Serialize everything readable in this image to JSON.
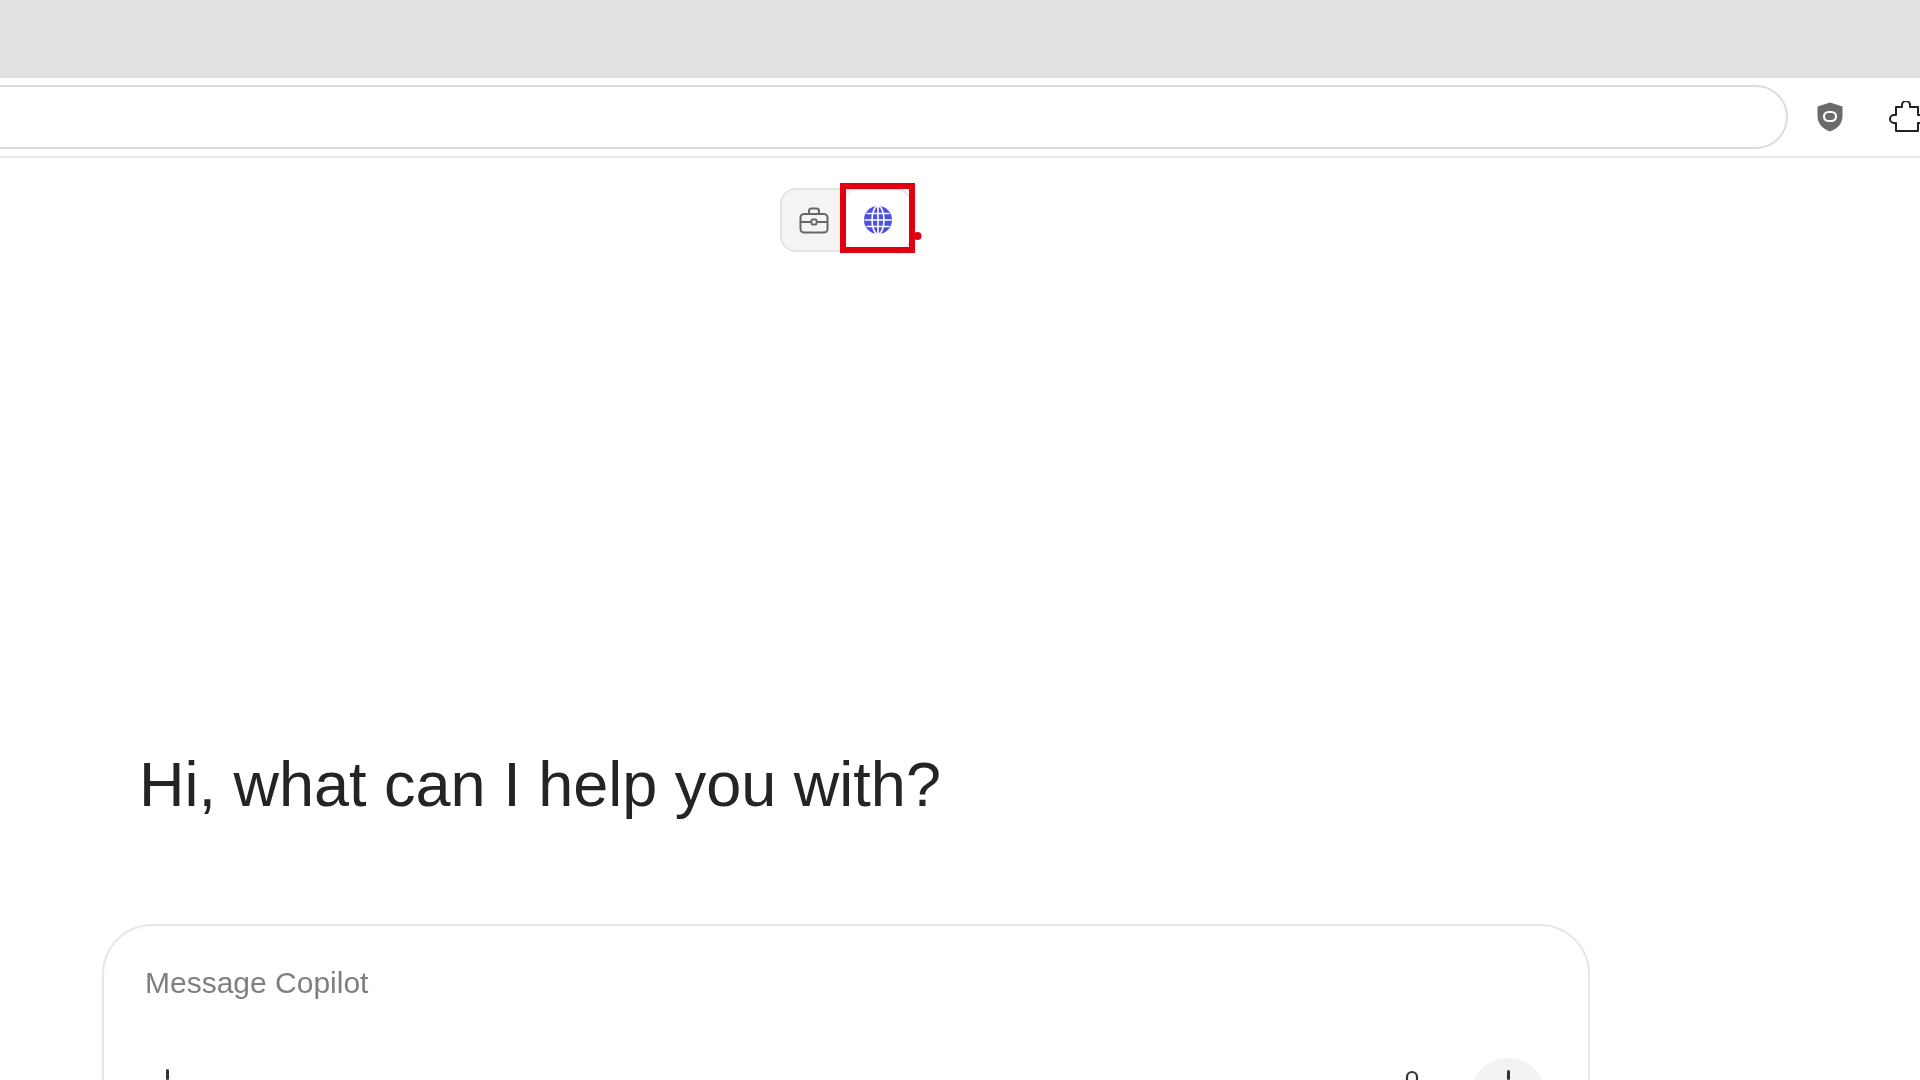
{
  "tools": [
    {
      "kind": "briefcase",
      "selected": false,
      "highlighted": false
    },
    {
      "kind": "globe",
      "selected": true,
      "highlighted": true
    }
  ],
  "heading": "Hi, what can I help you with?",
  "composer": {
    "placeholder": "Message Copilot"
  }
}
